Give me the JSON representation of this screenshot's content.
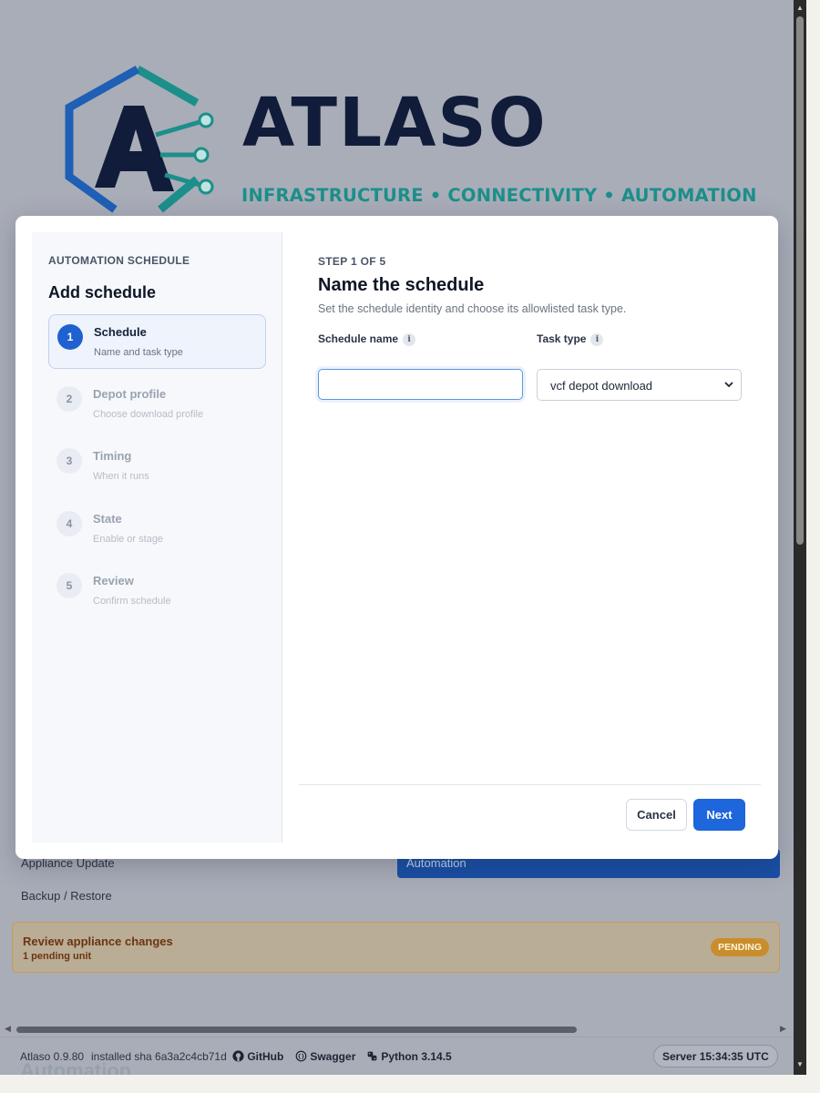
{
  "brand": {
    "wordmark": "ATLASO",
    "tagline": "INFRASTRUCTURE • CONNECTIVITY • AUTOMATION",
    "colors": {
      "navy": "#101c3a",
      "teal": "#1c8f8a",
      "blue": "#1f5fb5"
    }
  },
  "background": {
    "links": [
      "Appliance Update",
      "Backup / Restore"
    ],
    "active_nav": "Automation",
    "banner": {
      "title": "Review appliance changes",
      "subtitle": "1 pending unit",
      "badge": "PENDING"
    },
    "ghost_heading": "Automation"
  },
  "footer": {
    "version": "Atlaso 0.9.80",
    "sha": "installed sha 6a3a2c4cb71d",
    "github": "GitHub",
    "swagger": "Swagger",
    "python": "Python 3.14.5",
    "server_time": "Server 15:34:35 UTC"
  },
  "modal": {
    "eyebrow": "AUTOMATION SCHEDULE",
    "title": "Add schedule",
    "steps": [
      {
        "num": "1",
        "label": "Schedule",
        "sub": "Name and task type",
        "active": true
      },
      {
        "num": "2",
        "label": "Depot profile",
        "sub": "Choose download profile",
        "active": false
      },
      {
        "num": "3",
        "label": "Timing",
        "sub": "When it runs",
        "active": false
      },
      {
        "num": "4",
        "label": "State",
        "sub": "Enable or stage",
        "active": false
      },
      {
        "num": "5",
        "label": "Review",
        "sub": "Confirm schedule",
        "active": false
      }
    ],
    "step_indicator": "STEP 1 OF 5",
    "heading": "Name the schedule",
    "description": "Set the schedule identity and choose its allowlisted task type.",
    "fields": {
      "schedule_name": {
        "label": "Schedule name",
        "value": "",
        "placeholder": ""
      },
      "task_type": {
        "label": "Task type",
        "value": "vcf depot download"
      }
    },
    "buttons": {
      "cancel": "Cancel",
      "next": "Next"
    },
    "accent": "#1d66dc"
  }
}
